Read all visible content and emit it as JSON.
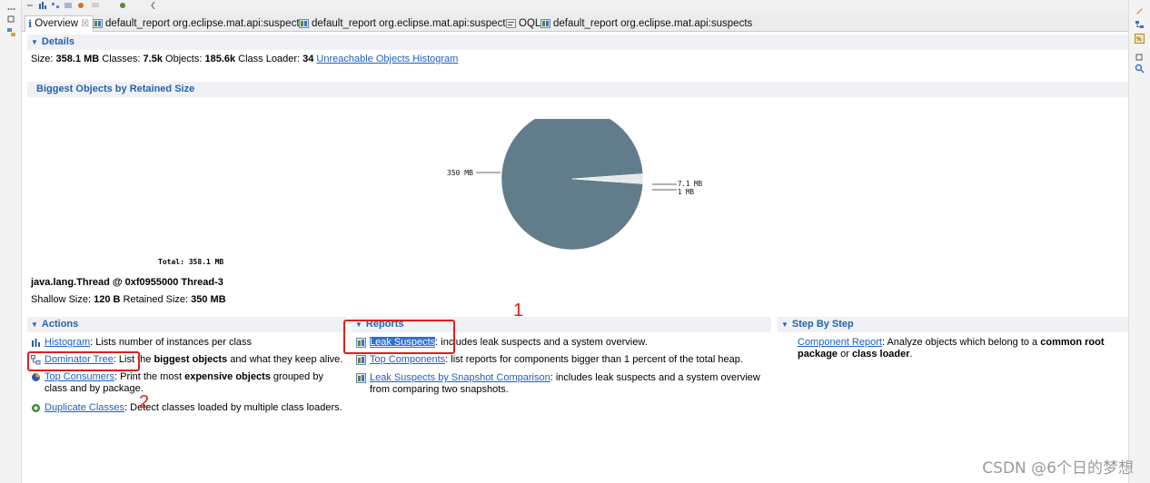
{
  "tabs": [
    {
      "label": "Overview",
      "close": "☒"
    },
    {
      "label": "default_report  org.eclipse.mat.api:suspects"
    },
    {
      "label": "default_report  org.eclipse.mat.api:suspects"
    },
    {
      "label": "OQL"
    },
    {
      "label": "default_report  org.eclipse.mat.api:suspects"
    }
  ],
  "details": {
    "title": "Details",
    "size_label": "Size:",
    "size_value": "358.1 MB",
    "classes_label": "Classes:",
    "classes_value": "7.5k",
    "objects_label": "Objects:",
    "objects_value": "185.6k",
    "loader_label": "Class Loader:",
    "loader_value": "34",
    "unreachable_link": "Unreachable Objects Histogram"
  },
  "biggest": {
    "title": "Biggest Objects by Retained Size",
    "label_main": "350 MB",
    "label_small1": "7.1 MB",
    "label_small2": "1 MB",
    "total": "Total:  358.1 MB",
    "object_name": "java.lang.Thread @ 0xf0955000 Thread-3",
    "shallow_label": "Shallow Size:",
    "shallow_value": "120 B",
    "retained_label": "Retained Size:",
    "retained_value": "350 MB"
  },
  "chart_data": {
    "type": "pie",
    "values": [
      350,
      7.1,
      1
    ],
    "labels": [
      "350 MB",
      "7.1 MB",
      "1 MB"
    ],
    "colors": [
      "#617d8b",
      "#e5e8eb",
      "#c8ced3"
    ]
  },
  "actions": {
    "title": "Actions",
    "histogram_link": "Histogram",
    "histogram_desc": ": Lists number of instances per class",
    "dominator_link": "Dominator Tree",
    "dominator_desc1": ": List the ",
    "dominator_bold": "biggest objects",
    "dominator_desc2": " and what they keep alive.",
    "consumers_link": "Top Consumers",
    "consumers_desc1": ": Print the most ",
    "consumers_bold": "expensive objects",
    "consumers_desc2": " grouped by class and by package.",
    "duplicate_link": "Duplicate Classes",
    "duplicate_desc": ": Detect classes loaded by multiple class loaders."
  },
  "reports": {
    "title": "Reports",
    "leak_link": "Leak Suspects",
    "leak_desc": ": includes leak suspects and a system overview.",
    "components_link": "Top Components",
    "components_desc": ": list reports for components bigger than 1 percent of the total heap.",
    "snapshot_link": "Leak Suspects by Snapshot Comparison",
    "snapshot_desc": ": includes leak suspects and a system overview from comparing two snapshots."
  },
  "stepbystep": {
    "title": "Step By Step",
    "component_link": "Component Report",
    "component_desc1": ": Analyze objects which belong to a ",
    "component_bold1": "common root package",
    "component_desc2": " or ",
    "component_bold2": "class loader",
    "component_desc3": "."
  },
  "annotations": {
    "num1": "1",
    "num2": "2"
  },
  "watermark": "CSDN @6个日的梦想"
}
